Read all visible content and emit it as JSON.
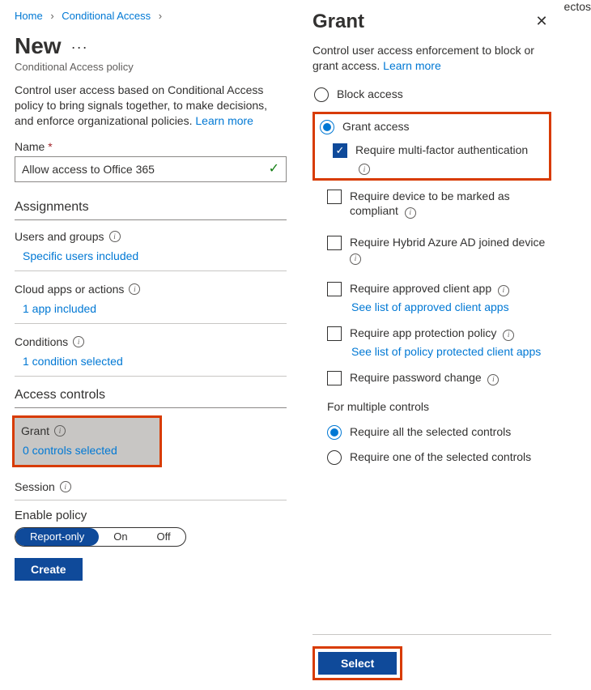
{
  "breadcrumb": {
    "home": "Home",
    "ca": "Conditional Access"
  },
  "page": {
    "title": "New",
    "subtitle": "Conditional Access policy",
    "description": "Control user access based on Conditional Access policy to bring signals together, to make decisions, and enforce organizational policies. ",
    "learn_more": "Learn more"
  },
  "name": {
    "label": "Name",
    "value": "Allow access to Office 365"
  },
  "sections": {
    "assignments": "Assignments",
    "access_controls": "Access controls"
  },
  "assignments": {
    "users": {
      "title": "Users and groups",
      "link": "Specific users included"
    },
    "apps": {
      "title": "Cloud apps or actions",
      "link": "1 app included"
    },
    "conditions": {
      "title": "Conditions",
      "link": "1 condition selected"
    }
  },
  "controls": {
    "grant": {
      "title": "Grant",
      "status": "0 controls selected"
    },
    "session": {
      "title": "Session"
    }
  },
  "enable": {
    "label": "Enable policy",
    "opts": {
      "report": "Report-only",
      "on": "On",
      "off": "Off"
    }
  },
  "buttons": {
    "create": "Create",
    "select": "Select"
  },
  "panel": {
    "title": "Grant",
    "description": "Control user access enforcement to block or grant access. ",
    "learn_more": "Learn more",
    "block": "Block access",
    "grant": "Grant access",
    "require_mfa": "Require multi-factor authentication",
    "require_compliant": "Require device to be marked as compliant",
    "require_hybrid": "Require Hybrid Azure AD joined device",
    "require_approved": "Require approved client app",
    "approved_link": "See list of approved client apps",
    "require_protection": "Require app protection policy",
    "protection_link": "See list of policy protected client apps",
    "require_pwd": "Require password change",
    "multiple_hdr": "For multiple controls",
    "req_all": "Require all the selected controls",
    "req_one": "Require one of the selected controls"
  }
}
